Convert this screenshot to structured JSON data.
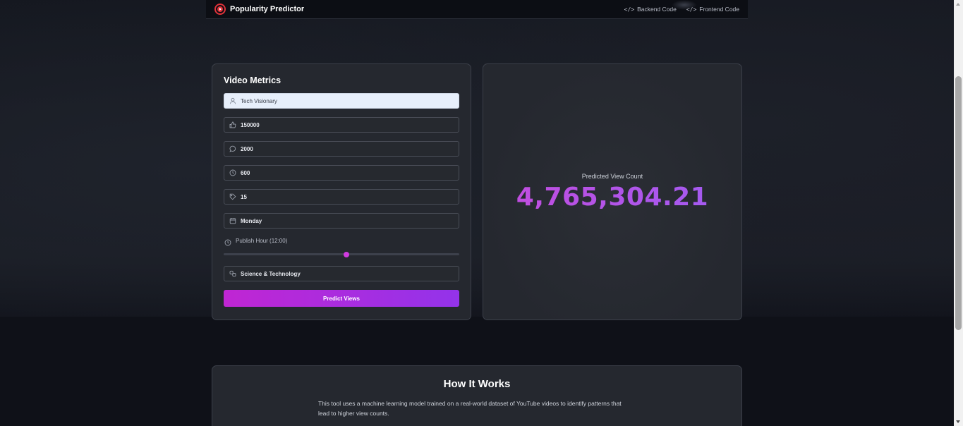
{
  "header": {
    "app_name": "Popularity Predictor",
    "links": [
      {
        "label": "Backend Code",
        "icon": "code-icon"
      },
      {
        "label": "Frontend Code",
        "icon": "code-icon"
      }
    ]
  },
  "metrics": {
    "title": "Video Metrics",
    "fields": [
      {
        "name": "channel",
        "icon": "user-icon",
        "value": "Tech Visionary"
      },
      {
        "name": "likes",
        "icon": "thumbs-up-icon",
        "value": "150000"
      },
      {
        "name": "comments",
        "icon": "message-circle-icon",
        "value": "2000"
      },
      {
        "name": "duration",
        "icon": "clock-icon",
        "value": "600"
      },
      {
        "name": "tags",
        "icon": "tag-icon",
        "value": "15"
      },
      {
        "name": "publish_day",
        "icon": "calendar-icon",
        "value": "Monday"
      }
    ],
    "publish_hour": {
      "label": "Publish Hour (12:00)",
      "icon": "clock-icon",
      "value": 12,
      "min": 0,
      "max": 23,
      "accent": "#d13be0"
    },
    "category": {
      "icon": "link-icon",
      "value": "Science & Technology"
    },
    "predict_label": "Predict Views",
    "button_gradient": [
      "#c026d3",
      "#9333ea"
    ]
  },
  "result": {
    "label": "Predicted View Count",
    "value": "4,765,304.21",
    "accent": "#b655ea"
  },
  "how_it_works": {
    "title": "How It Works",
    "text": "This tool uses a machine learning model trained on a real-world dataset of YouTube videos to identify patterns that lead to higher view counts."
  }
}
